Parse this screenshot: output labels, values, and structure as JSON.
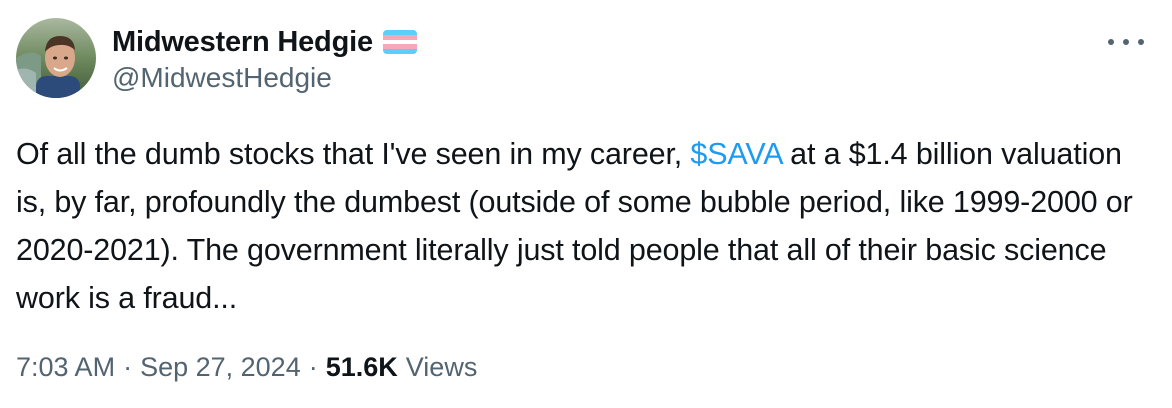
{
  "author": {
    "display_name": "Midwestern Hedgie",
    "handle": "@MidwestHedgie",
    "flag_icon": "transgender-flag-emoji",
    "flag_colors": [
      "#5BCEFA",
      "#F5A9B8",
      "#FFFFFF",
      "#F5A9B8",
      "#5BCEFA"
    ]
  },
  "tweet": {
    "text_before": "Of all the dumb stocks that I've seen in my career, ",
    "cashtag": "$SAVA",
    "text_after": " at a $1.4 billion valuation is, by far, profoundly the dumbest (outside of some bubble period, like 1999-2000 or 2020-2021). The government literally just told people that all of their basic science work is a fraud..."
  },
  "meta": {
    "time": "7:03 AM",
    "separator": "·",
    "date": "Sep 27, 2024",
    "views_count": "51.6K",
    "views_label": "Views"
  },
  "colors": {
    "link": "#1d9bf0",
    "secondary_text": "#536471",
    "primary_text": "#0f1419"
  },
  "icons": {
    "more": "more-horizontal-icon"
  }
}
